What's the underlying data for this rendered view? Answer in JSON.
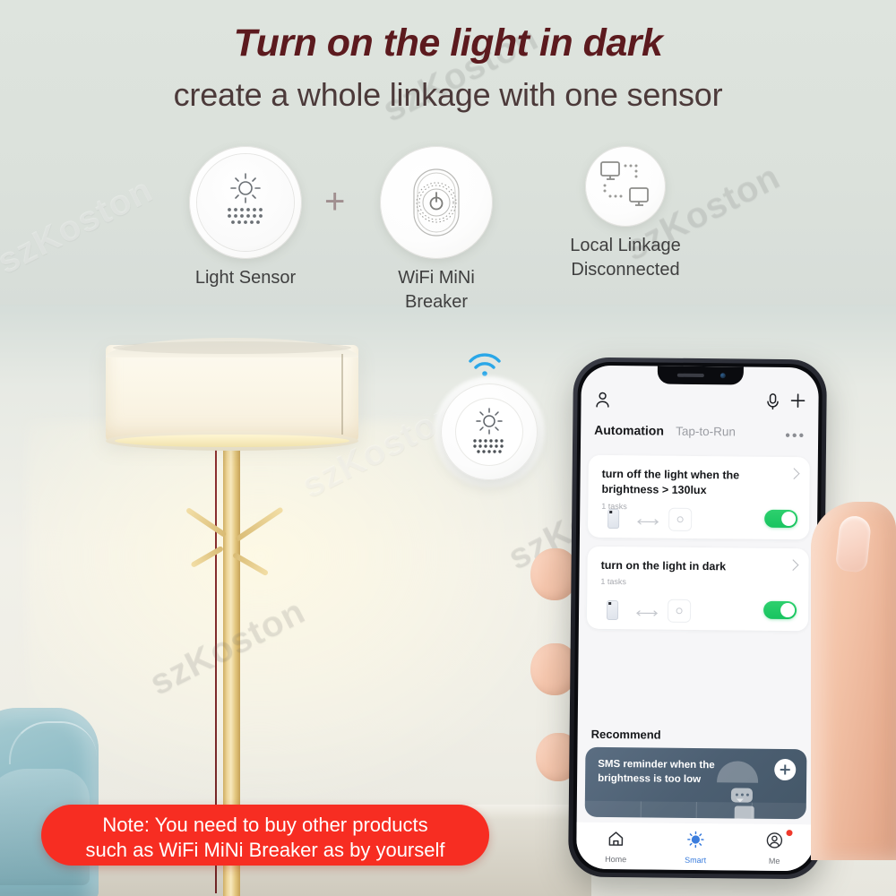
{
  "headline": {
    "title": "Turn on the light in dark",
    "subtitle": "create a whole linkage with one sensor",
    "title_color": "#5c1a1e"
  },
  "products": {
    "separator": "+",
    "items": [
      {
        "label": "Light Sensor",
        "icon": "light-sensor-icon"
      },
      {
        "label": "WiFi MiNi Breaker",
        "icon": "wifi-mini-breaker-icon"
      },
      {
        "label": "Local Linkage\nDisconnected",
        "label_line1": "Local Linkage",
        "label_line2": "Disconnected",
        "icon": "local-linkage-icon"
      }
    ]
  },
  "scene": {
    "watermark": "szKoston",
    "device_icon": "light-sensor-puck",
    "wifi_icon": "wifi-signal-icon"
  },
  "phone": {
    "header": {
      "profile_icon": "person-icon",
      "voice_icon": "microphone-icon",
      "add_icon": "plus-icon"
    },
    "tabs": [
      {
        "label": "Automation",
        "active": true
      },
      {
        "label": "Tap-to-Run",
        "active": false
      }
    ],
    "more_icon": "more-horizontal-icon",
    "automations": [
      {
        "title": "turn off the light when the brightness  > 130lux",
        "tasks": "1 tasks",
        "toggle_on": true,
        "chevron_icon": "chevron-right-icon",
        "trigger_icon": "sensor-device-icon",
        "link_icon": "double-arrow-icon",
        "action_icon": "action-device-icon"
      },
      {
        "title": "turn on the light in dark",
        "tasks": "1 tasks",
        "toggle_on": true,
        "chevron_icon": "chevron-right-icon",
        "trigger_icon": "sensor-device-icon",
        "link_icon": "double-arrow-icon",
        "action_icon": "action-device-icon"
      }
    ],
    "recommend": {
      "heading": "Recommend",
      "card_title": "SMS reminder when the brightness is too low",
      "add_icon": "plus-circle-icon",
      "accent_color": "#4c5f72"
    },
    "navbar": [
      {
        "label": "Home",
        "icon": "home-icon",
        "active": false,
        "badge": false
      },
      {
        "label": "Smart",
        "icon": "smart-sun-icon",
        "active": true,
        "badge": false
      },
      {
        "label": "Me",
        "icon": "account-icon",
        "active": false,
        "badge": true
      }
    ],
    "toggle_on_color": "#1fc860",
    "active_color": "#3b7ddd"
  },
  "note": {
    "line1": "Note: You need to buy other products",
    "line2": "such as WiFi MiNi Breaker as by yourself",
    "background": "#f72d22"
  }
}
